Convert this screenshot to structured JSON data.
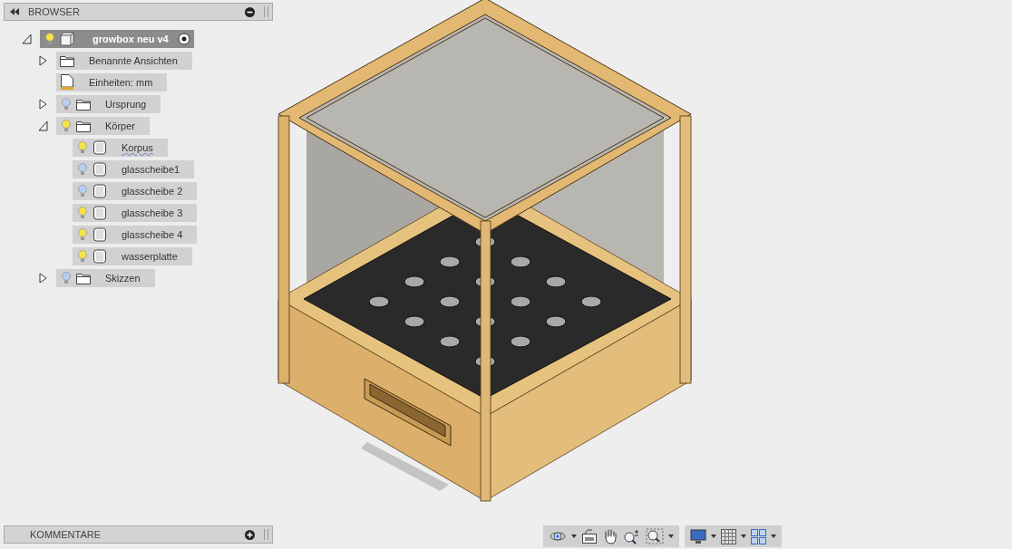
{
  "browser": {
    "title": "BROWSER",
    "tree": [
      {
        "label": "growbox neu v4",
        "kind": "component",
        "visible": true,
        "expanded": true,
        "selected": true,
        "children": [
          {
            "label": "Benannte Ansichten",
            "kind": "folder",
            "expanded": false,
            "selected": false
          },
          {
            "label": "Einheiten: mm",
            "kind": "units",
            "selected": false
          },
          {
            "label": "Ursprung",
            "kind": "folder",
            "visible": false,
            "expanded": false,
            "selected": false
          },
          {
            "label": "Körper",
            "kind": "folder",
            "visible": true,
            "expanded": true,
            "selected": false,
            "children": [
              {
                "label": "Korpus",
                "kind": "body",
                "visible": true,
                "warning": true,
                "selected": false
              },
              {
                "label": "glasscheibe1",
                "kind": "body",
                "visible": false,
                "warning": false,
                "selected": false
              },
              {
                "label": "glasscheibe 2",
                "kind": "body",
                "visible": false,
                "warning": false,
                "selected": false
              },
              {
                "label": "glasscheibe 3",
                "kind": "body",
                "visible": true,
                "warning": false,
                "selected": false
              },
              {
                "label": "glasscheibe 4",
                "kind": "body",
                "visible": true,
                "warning": false,
                "selected": false
              },
              {
                "label": "wasserplatte",
                "kind": "body",
                "visible": true,
                "warning": false,
                "selected": false
              }
            ]
          },
          {
            "label": "Skizzen",
            "kind": "folder",
            "visible": false,
            "expanded": false,
            "selected": false
          }
        ]
      }
    ]
  },
  "comments": {
    "title": "KOMMENTARE"
  }
}
